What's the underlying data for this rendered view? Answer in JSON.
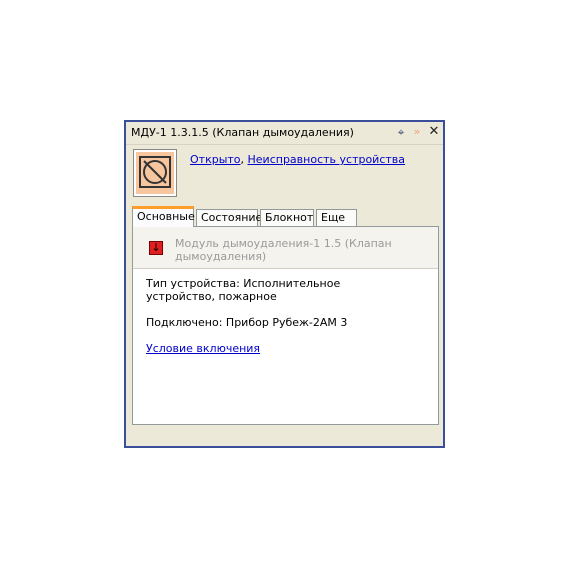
{
  "window": {
    "title": "МДУ-1 1.3.1.5 (Клапан дымоудаления)",
    "buttons": {
      "pin": "⌖",
      "expand": "»",
      "close": "✕"
    }
  },
  "status": {
    "state_link": "Открыто",
    "separator": ", ",
    "fault_link": "Неисправность устройства"
  },
  "tabs": [
    "Основные",
    "Состояние",
    "Блокнот",
    "Еще"
  ],
  "main": {
    "module_text": "Модуль дымоудаления-1 1.5 (Клапан дымоудаления)",
    "module_icon": "↓",
    "type_text": "Тип устройства: Исполнительное устройство, пожарное",
    "connected_text": "Подключено: Прибор Рубеж-2АМ 3",
    "condition_link": "Условие включения"
  },
  "colors": {
    "border": "#3a4f9a",
    "tab_accent": "#ff9c2b",
    "icon_fill": "#f7c69f",
    "module_icon": "#e02020"
  }
}
